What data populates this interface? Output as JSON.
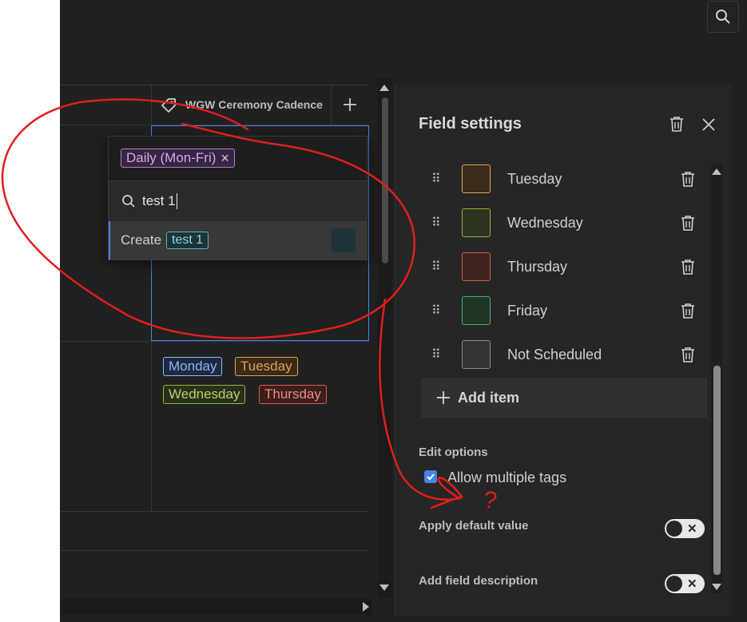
{
  "column": {
    "header": "WGW Ceremony Cadence"
  },
  "dropdown": {
    "selected_tag": "Daily (Mon-Fri)",
    "search_value": "test 1",
    "create_label": "Create",
    "create_tag": "test 1"
  },
  "cell_tags": [
    {
      "label": "Monday",
      "color": "#8fb4ff"
    },
    {
      "label": "Tuesday",
      "color": "#e0a35a"
    },
    {
      "label": "Wednesday",
      "color": "#b6d36b"
    },
    {
      "label": "Thursday",
      "color": "#f08a80"
    }
  ],
  "panel": {
    "title": "Field settings",
    "items": [
      {
        "label": "Tuesday",
        "color": "#e0a35a"
      },
      {
        "label": "Wednesday",
        "color": "#9ab33b"
      },
      {
        "label": "Thursday",
        "color": "#e0574b"
      },
      {
        "label": "Friday",
        "color": "#4caf67"
      },
      {
        "label": "Not Scheduled",
        "color": "#8a8a8a"
      }
    ],
    "add_item_label": "Add item",
    "edit_options_label": "Edit options",
    "allow_multiple_label": "Allow multiple tags",
    "allow_multiple_checked": true,
    "apply_default_label": "Apply default value",
    "add_description_label": "Add field description"
  },
  "annotation": {
    "question_mark": "?"
  },
  "colors": {
    "accent": "#4a84e8",
    "annotation": "#e01e1e",
    "purple_tag": "#c48be0",
    "teal_tag": "#4fb3c4"
  }
}
